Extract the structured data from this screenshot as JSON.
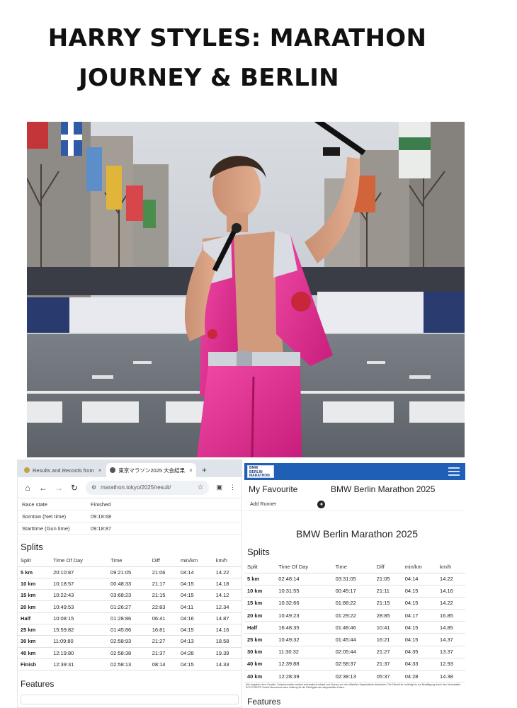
{
  "page": {
    "title_line1": "HARRY STYLES: MARATHON",
    "title_line2": "JOURNEY & BERLIN"
  },
  "browser": {
    "tabs": [
      {
        "label": "Results and Records from",
        "close": "×"
      },
      {
        "label": "東京マラソン2025 大会結果",
        "close": "×"
      }
    ],
    "new_tab": "+",
    "url": "marathon.tokyo/2025/result/"
  },
  "left_summary": [
    {
      "key": "Race state",
      "value": "Finished"
    },
    {
      "key": "Somtow (Net time)",
      "value": "09:18:68"
    },
    {
      "key": "Starttime (Gun time)",
      "value": "09:18:87"
    }
  ],
  "left_splits": {
    "heading": "Splits",
    "columns": [
      "Split",
      "Time Of Day",
      "Time",
      "Diff",
      "min/km",
      "km/h"
    ],
    "rows": [
      [
        "5 km",
        "20:10:87",
        "09:21:05",
        "21:06",
        "04:14",
        "14.22"
      ],
      [
        "10 km",
        "10:18:57",
        "00:48:33",
        "21:17",
        "04:15",
        "14.18"
      ],
      [
        "15 km",
        "10:22:43",
        "03:68:23",
        "21:15",
        "04:15",
        "14.12"
      ],
      [
        "20 km",
        "10:49:53",
        "01:26:27",
        "22:83",
        "04:11",
        "12.34"
      ],
      [
        "Half",
        "10:08:15",
        "01:28:86",
        "06:41",
        "04:16",
        "14.87"
      ],
      [
        "25 km",
        "15:59:82",
        "01:45:86",
        "16:81",
        "04:15",
        "14.16"
      ],
      [
        "30 km",
        "11:09:80",
        "02:58:93",
        "21:27",
        "04:13",
        "18.58"
      ],
      [
        "40 km",
        "12:19:80",
        "02:58:38",
        "21:37",
        "04:28",
        "19.39"
      ],
      [
        "Finish",
        "12:39:31",
        "02:58:13",
        "08:14",
        "04:15",
        "14.33"
      ]
    ]
  },
  "left_features_heading": "Features",
  "right_page": {
    "logo_text": "BMW BERLIN MARATHON",
    "favourite_label": "My Favourite",
    "event_name": "BMW Berlin Marathon 2025",
    "add_label": "Add Runner",
    "plus": "+",
    "big_title": "BMW Berlin Marathon 2025",
    "splits_heading": "Splits",
    "columns": [
      "Split",
      "Time Of Day",
      "Time",
      "Diff",
      "min/km",
      "km/h"
    ],
    "rows": [
      [
        "5 km",
        "02:48:14",
        "03:31:05",
        "21:05",
        "04:14",
        "14.22"
      ],
      [
        "10 km",
        "10:31:55",
        "00:45:17",
        "21:11",
        "04:15",
        "14.16"
      ],
      [
        "15 km",
        "10:32:66",
        "01:88:22",
        "21:15",
        "04:15",
        "14.22"
      ],
      [
        "20 km",
        "10:49:23",
        "01:29:22",
        "28:85",
        "04:17",
        "16.85"
      ],
      [
        "Half",
        "16:48:35",
        "01:48:46",
        "10:41",
        "04:15",
        "14.85"
      ],
      [
        "25 km",
        "10:49:32",
        "01:45:44",
        "16:21",
        "04:15",
        "14.37"
      ],
      [
        "30 km",
        "11:30:32",
        "02:05:44",
        "21:27",
        "04:35",
        "13.37"
      ],
      [
        "40 km",
        "12:39:88",
        "02:58:37",
        "21:37",
        "04:33",
        "12.93"
      ],
      [
        "40 km",
        "12:28:39",
        "02:38:13",
        "05:37",
        "04:28",
        "14.38"
      ]
    ],
    "fine_print": "Alle Angaben ohne Gewähr. Zwischenzeiten werden automatisch erfasst und können von der offiziellen Ergebnisliste abweichen. Die Zielzeit ist vorläufig bis zur Bestätigung durch den Veranstalter. SCC EVENTS GmbH übernimmt keine Haftung für die Richtigkeit der dargestellten Daten.",
    "features_heading": "Features"
  }
}
